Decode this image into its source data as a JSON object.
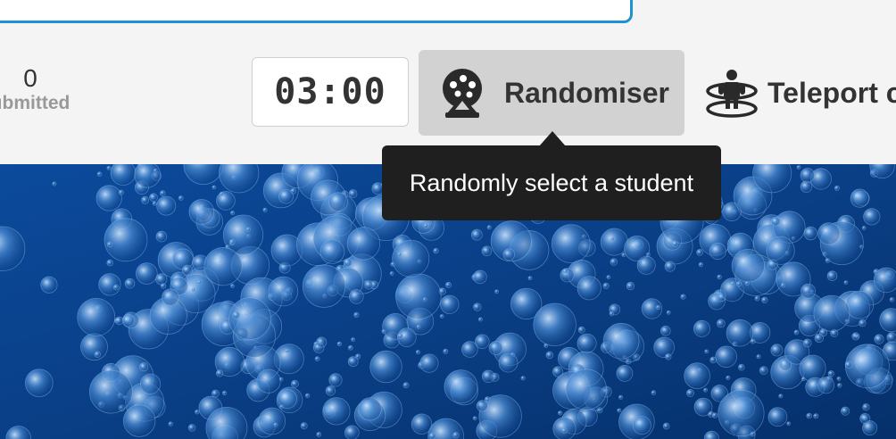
{
  "stats": {
    "count": "0",
    "label": "ubmitted"
  },
  "timer": {
    "value": "03:00"
  },
  "toolbar": {
    "randomiser_label": "Randomiser",
    "teleport_label": "Teleport c"
  },
  "tooltip": {
    "text": "Randomly select a student"
  },
  "icons": {
    "randomiser": "gumball-machine-icon",
    "teleport": "teleport-icon"
  },
  "colors": {
    "accent_border": "#1e90d6",
    "button_active_bg": "#d2d2d2",
    "tooltip_bg": "#1f1f1f",
    "water_deep": "#0a3f86"
  }
}
